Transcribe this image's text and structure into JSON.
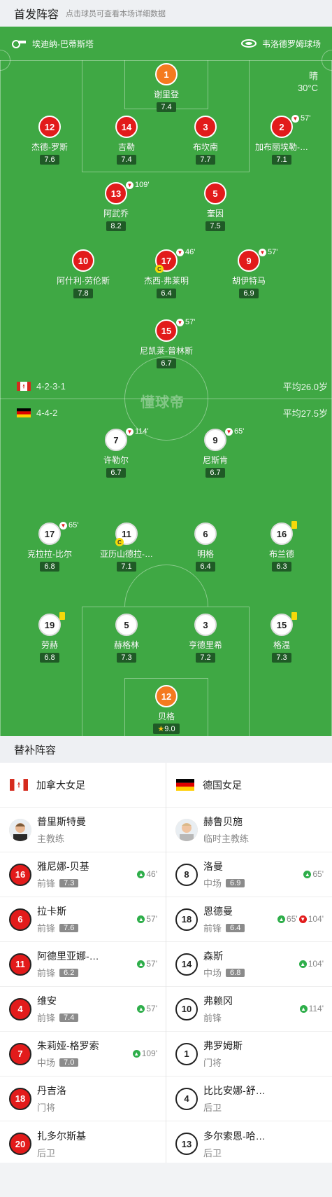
{
  "header": {
    "title": "首发阵容",
    "hint": "点击球员可查看本场详细数据"
  },
  "venue": {
    "referee": "埃迪纳-巴蒂斯塔",
    "stadium": "韦洛德罗姆球场"
  },
  "weather": {
    "condition": "晴",
    "temp": "30°C"
  },
  "watermark": "懂球帝",
  "home": {
    "formation": "4-2-3-1",
    "avg_age": "平均26.0岁",
    "players": [
      {
        "num": "1",
        "name": "谢里登",
        "rating": "7.4"
      },
      {
        "num": "12",
        "name": "杰德-罗斯",
        "rating": "7.6"
      },
      {
        "num": "14",
        "name": "吉勒",
        "rating": "7.4"
      },
      {
        "num": "3",
        "name": "布坎南",
        "rating": "7.7"
      },
      {
        "num": "2",
        "name": "加布丽埃勒-…",
        "rating": "7.1",
        "sub": "57'"
      },
      {
        "num": "13",
        "name": "阿武乔",
        "rating": "8.2",
        "sub": "109'"
      },
      {
        "num": "5",
        "name": "奎因",
        "rating": "7.5"
      },
      {
        "num": "10",
        "name": "阿什利-劳伦斯",
        "rating": "7.8"
      },
      {
        "num": "17",
        "name": "杰西-弗莱明",
        "rating": "6.4",
        "sub": "46'",
        "captain": "C"
      },
      {
        "num": "9",
        "name": "胡伊特马",
        "rating": "6.9",
        "sub": "57'"
      },
      {
        "num": "15",
        "name": "尼凯莱-普林斯",
        "rating": "6.7",
        "sub": "57'"
      }
    ]
  },
  "away": {
    "formation": "4-4-2",
    "avg_age": "平均27.5岁",
    "players": [
      {
        "num": "7",
        "name": "许勒尔",
        "rating": "6.7",
        "sub": "114'"
      },
      {
        "num": "9",
        "name": "尼斯肯",
        "rating": "6.7",
        "sub": "65'"
      },
      {
        "num": "17",
        "name": "克拉拉-比尔",
        "rating": "6.8",
        "sub": "65'"
      },
      {
        "num": "11",
        "name": "亚历山德拉-…",
        "rating": "7.1",
        "captain": "C"
      },
      {
        "num": "6",
        "name": "明格",
        "rating": "6.4"
      },
      {
        "num": "16",
        "name": "布兰德",
        "rating": "6.3"
      },
      {
        "num": "19",
        "name": "劳赫",
        "rating": "6.8"
      },
      {
        "num": "5",
        "name": "赫格林",
        "rating": "7.3"
      },
      {
        "num": "3",
        "name": "亨德里希",
        "rating": "7.2"
      },
      {
        "num": "15",
        "name": "格温",
        "rating": "7.3"
      },
      {
        "num": "12",
        "name": "贝格",
        "rating": "9.0"
      }
    ]
  },
  "subs": {
    "title": "替补阵容",
    "home_team": "加拿大女足",
    "away_team": "德国女足",
    "home_coach": {
      "name": "普里斯特曼",
      "role": "主教练"
    },
    "away_coach": {
      "name": "赫鲁贝施",
      "role": "临时主教练"
    },
    "home": [
      {
        "num": "16",
        "name": "雅尼娜-贝基",
        "pos": "前锋",
        "rating": "7.3",
        "in": "46'"
      },
      {
        "num": "6",
        "name": "拉卡斯",
        "pos": "前锋",
        "rating": "7.6",
        "in": "57'"
      },
      {
        "num": "11",
        "name": "阿德里亚娜-…",
        "pos": "前锋",
        "rating": "6.2",
        "in": "57'"
      },
      {
        "num": "4",
        "name": "维安",
        "pos": "前锋",
        "rating": "7.4",
        "in": "57'"
      },
      {
        "num": "7",
        "name": "朱莉娅-格罗索",
        "pos": "中场",
        "rating": "7.0",
        "in": "109'"
      },
      {
        "num": "18",
        "name": "丹吉洛",
        "pos": "门将"
      },
      {
        "num": "20",
        "name": "扎多尔斯基",
        "pos": "后卫"
      }
    ],
    "away": [
      {
        "num": "8",
        "name": "洛曼",
        "pos": "中场",
        "rating": "6.9",
        "in": "65'"
      },
      {
        "num": "18",
        "name": "恩德曼",
        "pos": "前锋",
        "rating": "6.4",
        "in": "65'",
        "out": "104'"
      },
      {
        "num": "14",
        "name": "森斯",
        "pos": "中场",
        "rating": "6.8",
        "in": "104'"
      },
      {
        "num": "10",
        "name": "弗赖冈",
        "pos": "前锋",
        "in": "114'"
      },
      {
        "num": "1",
        "name": "弗罗姆斯",
        "pos": "门将"
      },
      {
        "num": "4",
        "name": "比比安娜-舒…",
        "pos": "后卫"
      },
      {
        "num": "13",
        "name": "多尔索恩-哈…",
        "pos": "后卫"
      }
    ]
  }
}
